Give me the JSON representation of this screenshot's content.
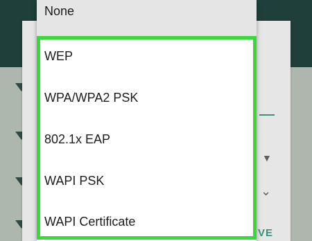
{
  "security_menu": {
    "options": [
      {
        "label": "None"
      },
      {
        "label": "WEP"
      },
      {
        "label": "WPA/WPA2 PSK"
      },
      {
        "label": "802.1x EAP"
      },
      {
        "label": "WAPI PSK"
      },
      {
        "label": "WAPI Certificate"
      }
    ],
    "highlight_color": "#39d83b"
  },
  "background_dialog": {
    "save_button_fragment": "VE"
  },
  "colors": {
    "header": "#1f3f3a",
    "accent": "#3a8f7e"
  }
}
